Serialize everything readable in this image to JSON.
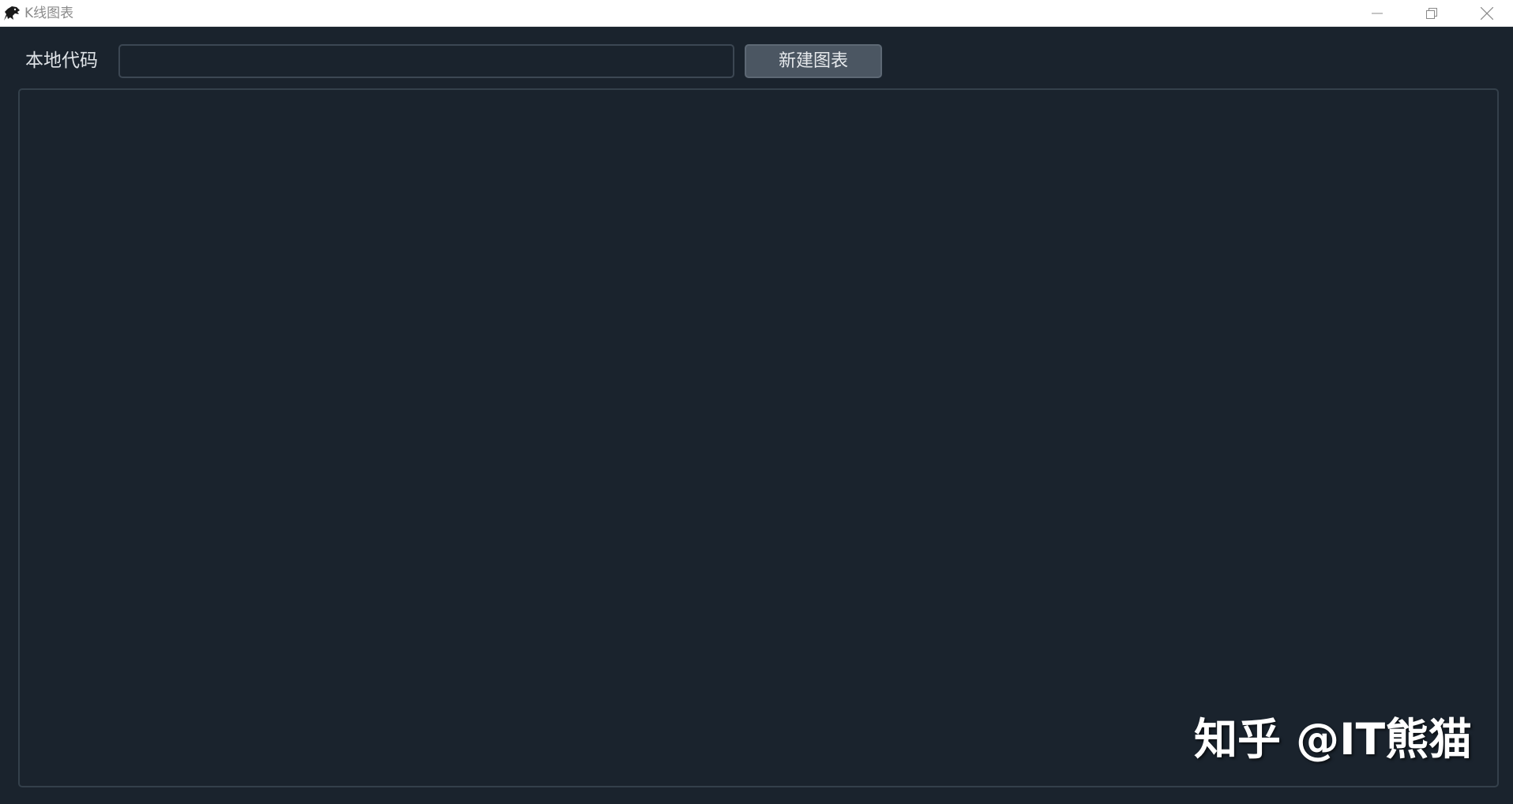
{
  "window": {
    "title": "K线图表",
    "controls": {
      "minimize_icon": "minimize-icon",
      "restore_icon": "restore-icon",
      "close_icon": "close-icon"
    }
  },
  "toolbar": {
    "code_label": "本地代码",
    "code_input_value": "",
    "new_chart_label": "新建图表"
  },
  "watermark": {
    "text": "知乎 @IT熊猫"
  },
  "colors": {
    "background": "#1a232d",
    "button": "#4b5662",
    "panel_border": "#34404b",
    "titlebar": "#ffffff"
  }
}
